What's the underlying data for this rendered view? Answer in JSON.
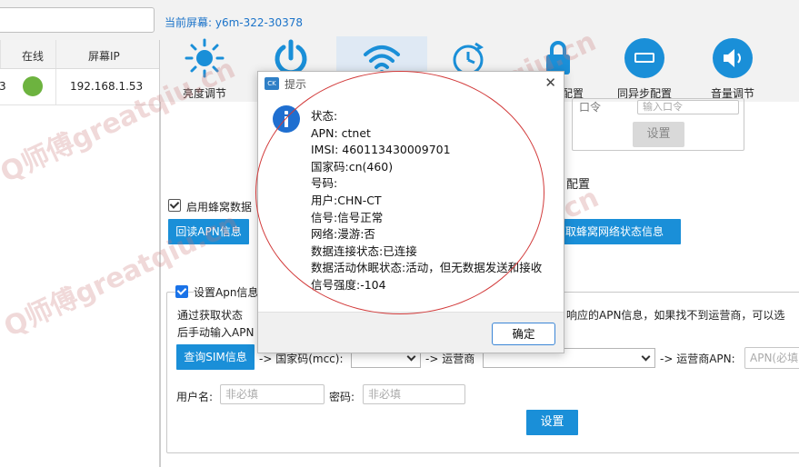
{
  "header": {
    "current_screen_prefix": "当前屏幕:",
    "current_screen_id": "y6m-322-30378"
  },
  "device_table": {
    "columns": [
      "在线",
      "屏幕IP"
    ],
    "rows": [
      {
        "partial_id": "3",
        "online": true,
        "ip": "192.168.1.53"
      }
    ]
  },
  "toolbar": {
    "items": [
      {
        "label": "亮度调节",
        "icon": "sun-icon"
      },
      {
        "label": "",
        "icon": "power-icon"
      },
      {
        "label": "",
        "icon": "wifi-icon"
      },
      {
        "label": "",
        "icon": "clock-sync-icon"
      },
      {
        "label": "配置",
        "icon": "lock-icon"
      },
      {
        "label": "同异步配置",
        "icon": "hdmi-icon"
      },
      {
        "label": "音量调节",
        "icon": "speaker-icon"
      }
    ],
    "active_index": 2
  },
  "top_section": {
    "password_label": "口令",
    "password_placeholder": "输入口令",
    "set_button": "设置"
  },
  "cellular": {
    "section_title": "配置",
    "enable_checkbox_label": "启用蜂窝数据",
    "read_apn_button": "回读APN信息",
    "get_status_button": "取蜂窝网络状态信息"
  },
  "apn": {
    "checkbox_label": "设置Apn信息",
    "hint_line1_left": "通过获取状态",
    "hint_line1_right": "响应的APN信息，如果找不到运营商，可以选",
    "hint_line2": "后手动输入APN",
    "query_sim_button": "查询SIM信息",
    "country_code_label": "-> 国家码(mcc):",
    "operator_label": "-> 运营商",
    "operator_apn_label": "-> 运营商APN:",
    "operator_apn_placeholder": "APN(必填",
    "username_label": "用户名:",
    "username_placeholder": "非必填",
    "password_label": "密码:",
    "password_placeholder": "非必填",
    "set_button": "设置"
  },
  "dialog": {
    "app_icon_text": "CK",
    "title": "提示",
    "close_glyph": "✕",
    "lines": [
      "状态:",
      "APN: ctnet",
      "IMSI: 460113430009701",
      "国家码:cn(460)",
      "号码:",
      "用户:CHN-CT",
      "信号:信号正常",
      "网络:漫游:否",
      "数据连接状态:已连接",
      "数据活动休眠状态:活动，但无数据发送和接收",
      "信号强度:-104"
    ],
    "ok_button": "确定"
  },
  "watermark": {
    "text": "Q师傅greatqiu.cn"
  },
  "colors": {
    "accent_blue": "#1a8fd8",
    "online_green": "#6db33f",
    "annotation_red": "#d23a3a"
  }
}
